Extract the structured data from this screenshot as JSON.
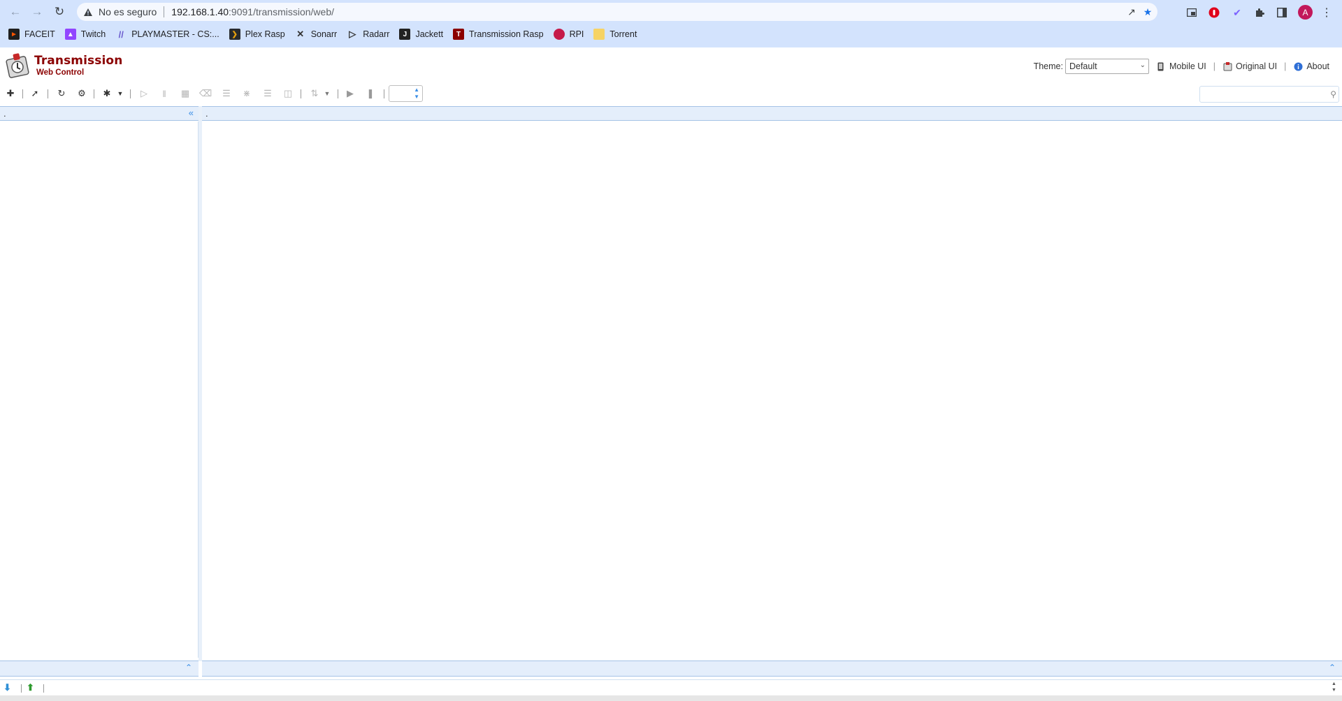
{
  "browser": {
    "security_label": "No es seguro",
    "url_host": "192.168.1.40",
    "url_rest": ":9091/transmission/web/",
    "profile_initial": "A",
    "bookmarks": [
      {
        "label": "FACEIT",
        "icon": "faceit-icon",
        "color": "#1f1f1f"
      },
      {
        "label": "Twitch",
        "icon": "twitch-icon",
        "color": "#9146ff"
      },
      {
        "label": "PLAYMASTER - CS:...",
        "icon": "playmaster-icon",
        "color": "#6a5acd"
      },
      {
        "label": "Plex Rasp",
        "icon": "plex-icon",
        "color": "#282a2d"
      },
      {
        "label": "Sonarr",
        "icon": "sonarr-icon",
        "color": "#35c5f4"
      },
      {
        "label": "Radarr",
        "icon": "radarr-icon",
        "color": "#ffc230"
      },
      {
        "label": "Jackett",
        "icon": "jackett-icon",
        "color": "#222222"
      },
      {
        "label": "Transmission Rasp",
        "icon": "transmission-icon",
        "color": "#8b0000"
      },
      {
        "label": "RPI",
        "icon": "raspberry-icon",
        "color": "#c51a4a"
      },
      {
        "label": "Torrent",
        "icon": "folder-icon",
        "color": "#f6d365"
      }
    ]
  },
  "header": {
    "title": "Transmission",
    "subtitle": "Web Control",
    "theme_label": "Theme:",
    "theme_value": "Default",
    "links": {
      "mobile": "Mobile UI",
      "original": "Original UI",
      "about": "About"
    }
  },
  "panels": {
    "left_title": ".",
    "main_title": "."
  },
  "colors": {
    "brand": "#8b0000",
    "accent": "#3a8ee6",
    "panel_header": "#e4eefb",
    "chrome_bg": "#d3e3fd"
  }
}
